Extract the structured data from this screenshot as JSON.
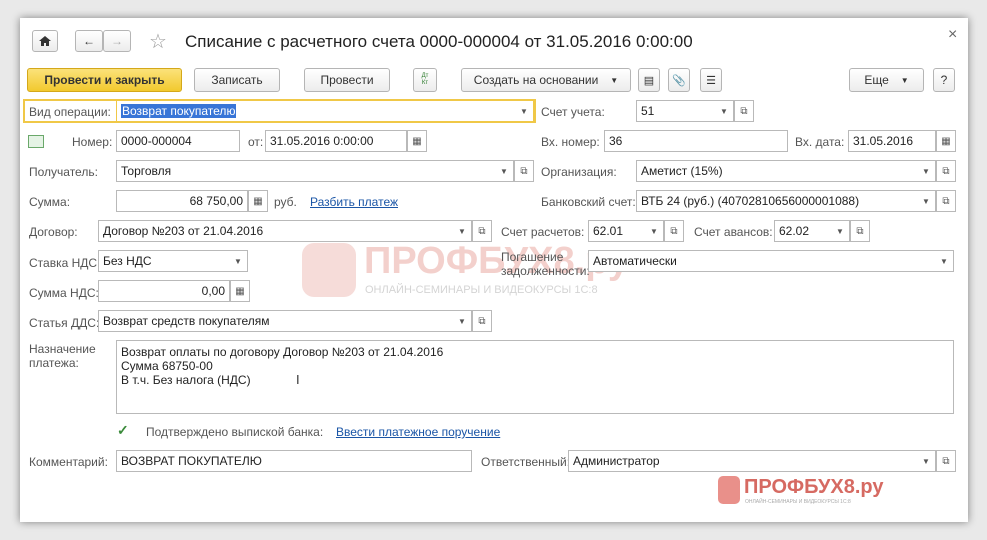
{
  "window": {
    "title": "Списание с расчетного счета 0000-000004 от 31.05.2016 0:00:00",
    "close_glyph": "×"
  },
  "toolbar": {
    "post_close": "Провести и закрыть",
    "save": "Записать",
    "post": "Провести",
    "dt_kt": "Дт Кт",
    "create_based": "Создать на основании",
    "more": "Еще",
    "help": "?"
  },
  "form": {
    "op_type_label": "Вид операции:",
    "op_type_value": "Возврат покупателю",
    "account_label": "Счет учета:",
    "account_value": "51",
    "number_label": "Номер:",
    "number_value": "0000-000004",
    "from_label": "от:",
    "date_value": "31.05.2016  0:00:00",
    "in_number_label": "Вх. номер:",
    "in_number_value": "36",
    "in_date_label": "Вх. дата:",
    "in_date_value": "31.05.2016",
    "recipient_label": "Получатель:",
    "recipient_value": "Торговля",
    "org_label": "Организация:",
    "org_value": "Аметист (15%)",
    "sum_label": "Сумма:",
    "sum_value": "68 750,00",
    "currency": "руб.",
    "split_link": "Разбить платеж",
    "bank_label": "Банковский счет:",
    "bank_value": "ВТБ 24 (руб.) (40702810656000001088)",
    "contract_label": "Договор:",
    "contract_value": "Договор №203 от 21.04.2016",
    "settle_label": "Счет расчетов:",
    "settle_value": "62.01",
    "advance_label": "Счет авансов:",
    "advance_value": "62.02",
    "vat_rate_label": "Ставка НДС:",
    "vat_rate_value": "Без НДС",
    "repay_label_1": "Погашение",
    "repay_label_2": "задолженности:",
    "repay_value": "Автоматически",
    "vat_sum_label": "Сумма НДС:",
    "vat_sum_value": "0,00",
    "dds_label": "Статья ДДС:",
    "dds_value": "Возврат средств покупателям",
    "purpose_label_1": "Назначение",
    "purpose_label_2": "платежа:",
    "purpose_line_1": "Возврат оплаты по договору Договор №203 от 21.04.2016",
    "purpose_line_2": "Сумма 68750-00",
    "purpose_line_3": "В т.ч. Без налога (НДС)",
    "confirmed_label": "Подтверждено выпиской банка:",
    "payment_order_link": "Ввести платежное поручение",
    "comment_label": "Комментарий:",
    "comment_value": "ВОЗВРАТ ПОКУПАТЕЛЮ",
    "responsible_label": "Ответственный:",
    "responsible_value": "Администратор"
  },
  "watermark": {
    "main": "ПРОФБУХ8.ру",
    "sub": "ОНЛАЙН-СЕМИНАРЫ И ВИДЕОКУРСЫ 1С:8",
    "small": "ПРОФБУХ8.ру",
    "small_sub": "ОНЛАЙН-СЕМИНАРЫ И ВИДЕОКУРСЫ 1С:8"
  },
  "colors": {
    "primary_button": "#f5d339",
    "link": "#1a55a6",
    "focus_border": "#f0c847"
  }
}
